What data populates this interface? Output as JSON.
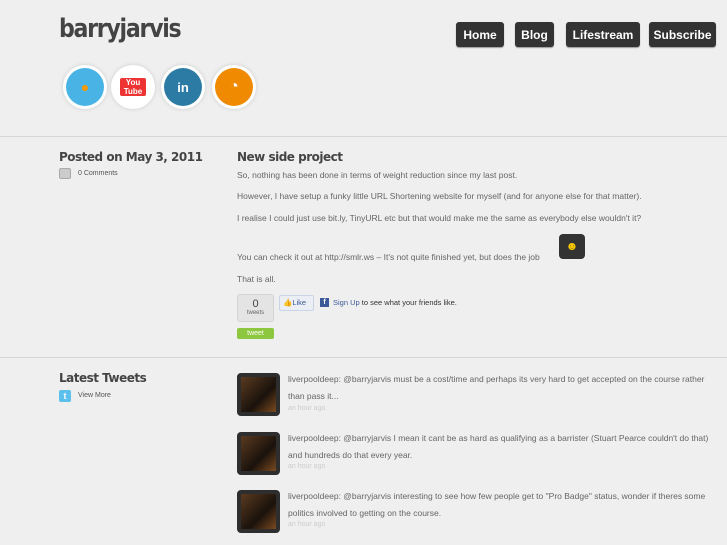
{
  "header": {
    "site_title": "barryjarvis",
    "nav": [
      "Home",
      "Blog",
      "Lifestream",
      "Subscribe"
    ],
    "social": [
      {
        "icon": "twitter-icon",
        "label": ""
      },
      {
        "icon": "youtube-icon",
        "label": "You Tube"
      },
      {
        "icon": "linkedin-icon",
        "label": "in"
      },
      {
        "icon": "rss-icon",
        "label": ""
      }
    ]
  },
  "post": {
    "posted_on": "Posted on May 3, 2011",
    "comments": "0 Comments",
    "title": "New side project",
    "paragraphs": [
      "So, nothing has been done in terms of weight reduction since my last post.",
      "However, I have setup a funky little URL Shortening website for myself (and for anyone else for that matter).",
      "I realise I could just use bit.ly, TinyURL etc but that would make me the same as everybody else wouldn't it?",
      "You can check it out at http://smlr.ws – It's not quite finished yet, but does the job",
      "That is all."
    ],
    "tweet_count": "0",
    "tweets_label": "tweets",
    "tweet_button": "tweet",
    "like": "Like",
    "sign_up": "Sign Up",
    "friends_text": "to see what your friends like."
  },
  "tweets": {
    "heading": "Latest Tweets",
    "view_more": "View More",
    "items": [
      {
        "text": "liverpooldeep: @barryjarvis must be a cost/time and perhaps its very hard to get accepted on the course rather than pass it...",
        "time": "an hour ago"
      },
      {
        "text": "liverpooldeep: @barryjarvis I mean it cant be as hard as qualifying as a barrister (Stuart Pearce couldn't do that) and hundreds do that every year.",
        "time": "an hour ago"
      },
      {
        "text": "liverpooldeep: @barryjarvis interesting to see how few people get to \"Pro Badge\" status, wonder if theres some politics involved to getting on the course.",
        "time": "an hour ago"
      }
    ]
  }
}
